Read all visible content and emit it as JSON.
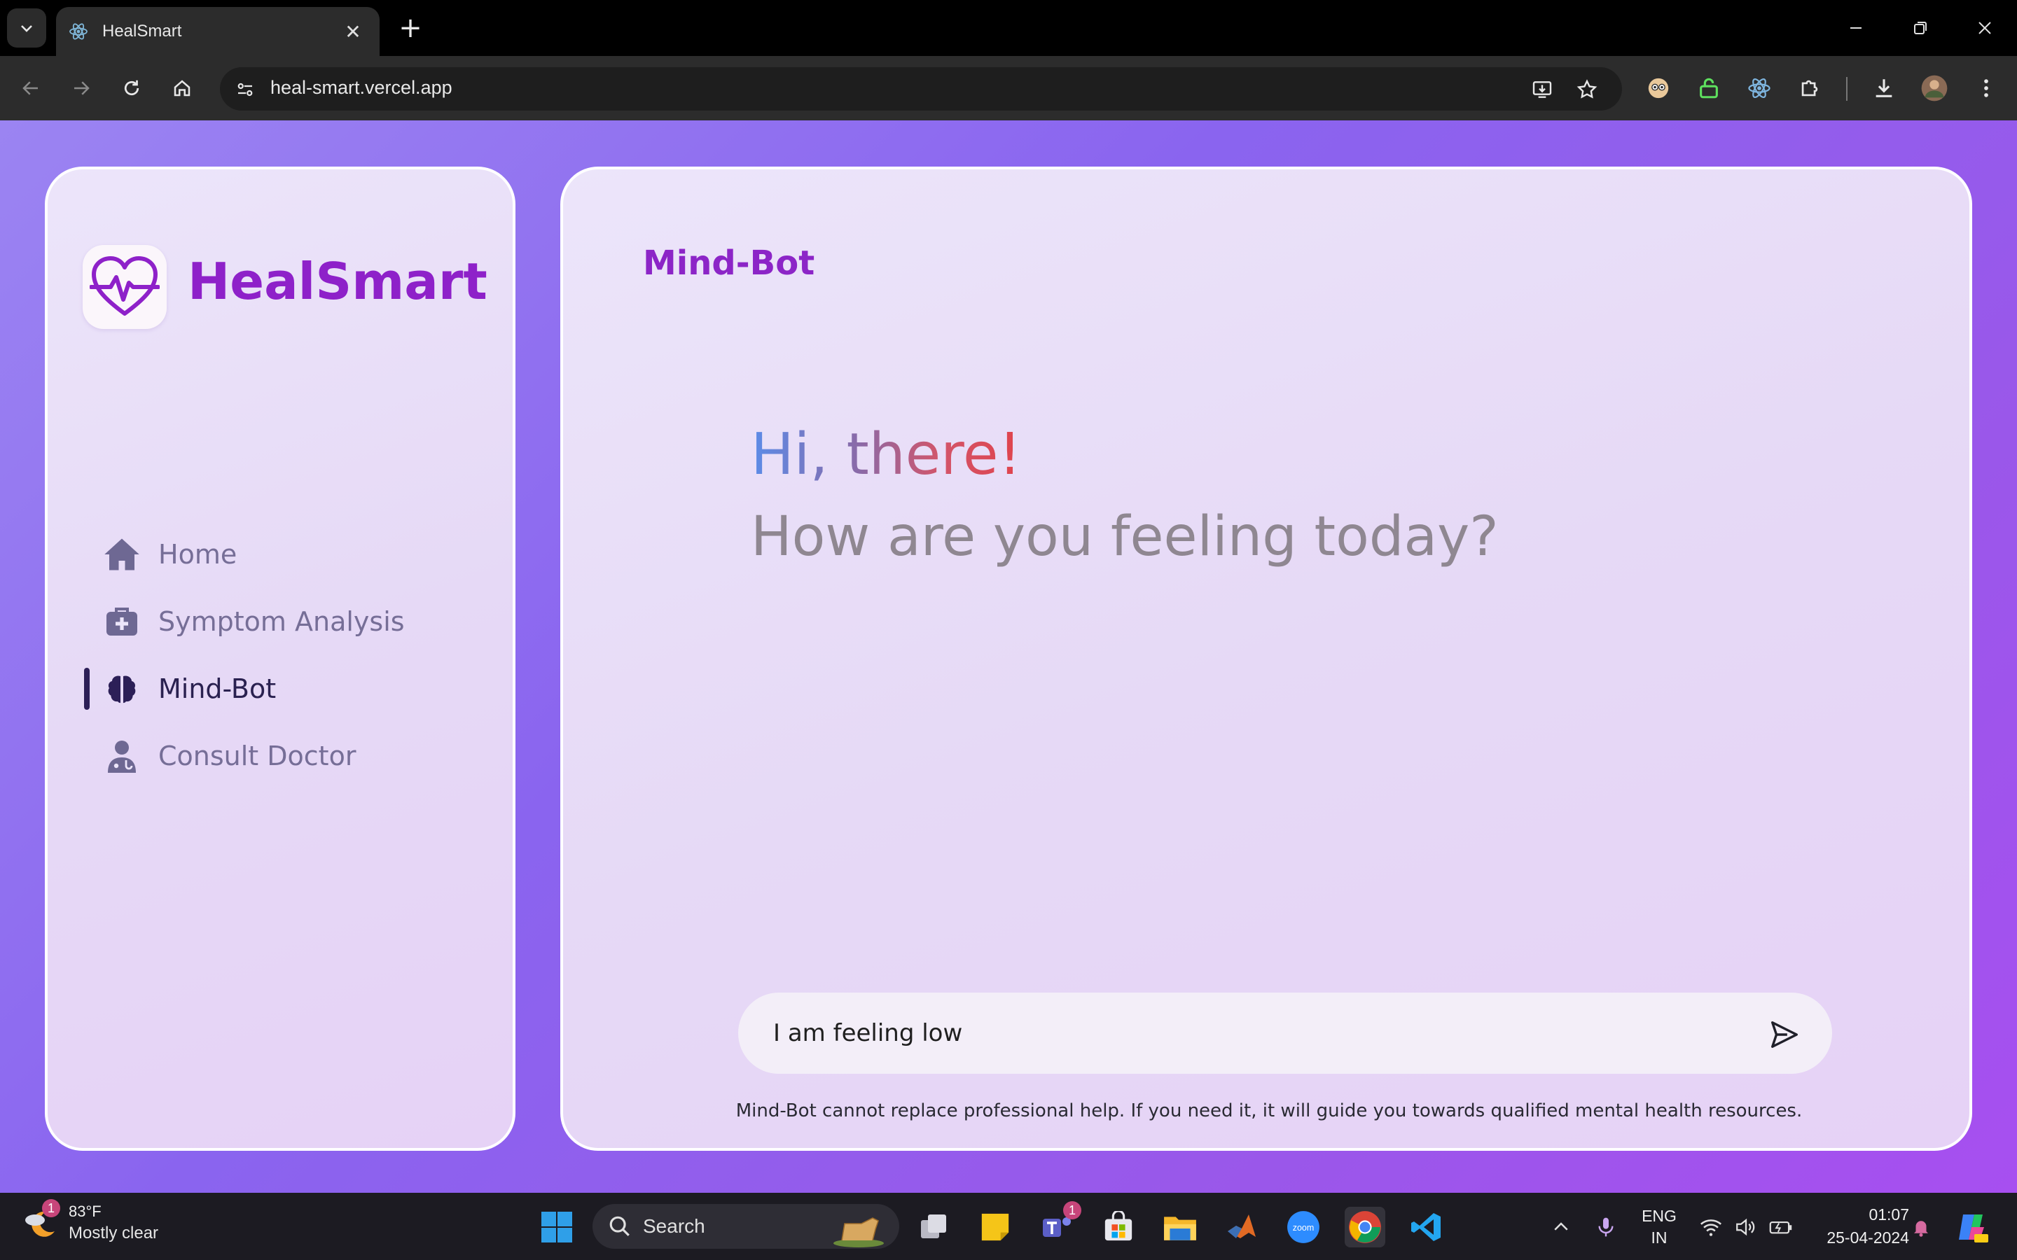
{
  "browser": {
    "tab_title": "HealSmart",
    "tab_close": "✕",
    "new_tab": "+",
    "url": "heal-smart.vercel.app"
  },
  "sidebar": {
    "brand": "HealSmart",
    "items": [
      {
        "label": "Home",
        "icon": "home-icon",
        "active": false
      },
      {
        "label": "Symptom Analysis",
        "icon": "medkit-icon",
        "active": false
      },
      {
        "label": "Mind-Bot",
        "icon": "brain-icon",
        "active": true
      },
      {
        "label": "Consult Doctor",
        "icon": "doctor-icon",
        "active": false
      }
    ]
  },
  "main": {
    "title": "Mind-Bot",
    "greeting": "Hi, there!",
    "question": "How are you feeling today?",
    "input_value": "I am feeling low",
    "disclaimer": "Mind-Bot cannot replace professional help. If you need it, it will guide you towards qualified mental health resources."
  },
  "taskbar": {
    "weather_temp": "83°F",
    "weather_cond": "Mostly clear",
    "weather_badge": "1",
    "search_label": "Search",
    "teams_badge": "1",
    "lang_line1": "ENG",
    "lang_line2": "IN",
    "time": "01:07",
    "date": "25-04-2024"
  },
  "colors": {
    "brand": "#8e21c9",
    "accent_dark": "#2c1f57",
    "nav_text": "#766e97"
  }
}
